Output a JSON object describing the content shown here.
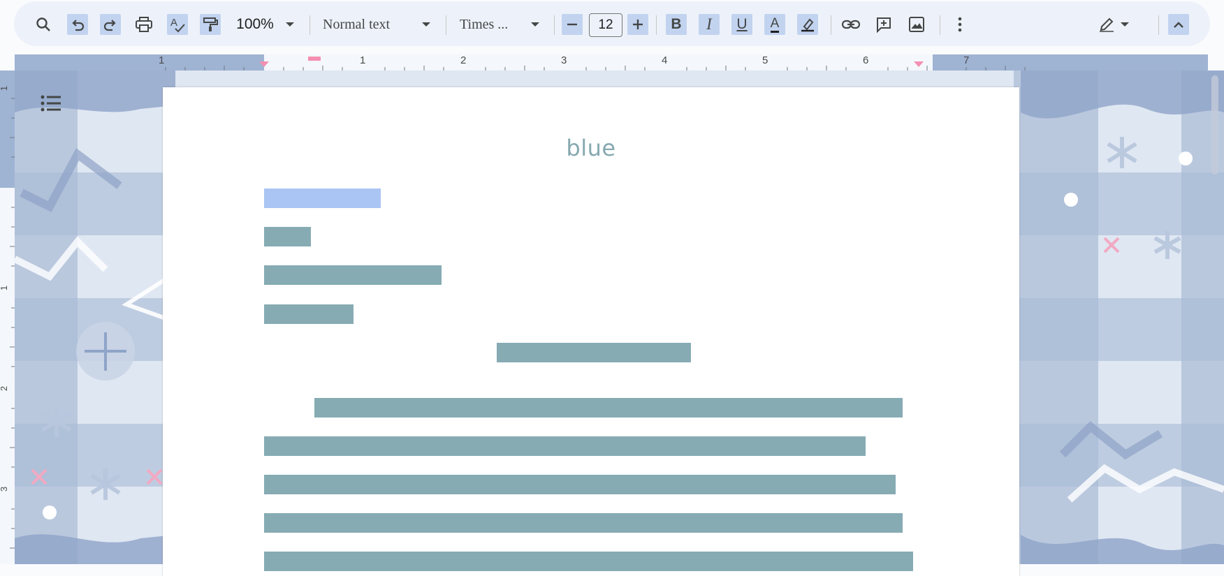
{
  "toolbar": {
    "zoom": "100%",
    "style": "Normal text",
    "font": "Times ...",
    "font_size": "12",
    "icons": {
      "search": "search-icon",
      "undo": "undo-icon",
      "redo": "redo-icon",
      "print": "print-icon",
      "spellcheck": "spellcheck-icon",
      "paint_format": "paint-format-icon",
      "decrease": "minus-icon",
      "increase": "plus-icon",
      "bold": "B",
      "italic": "I",
      "underline": "U",
      "text_color": "A",
      "highlight": "highlighter-icon",
      "link": "link-icon",
      "comment": "add-comment-icon",
      "image": "image-icon",
      "more": "more-vert-icon",
      "editing": "pencil-icon",
      "collapse": "chevron-up-icon"
    }
  },
  "ruler": {
    "h_numbers": [
      "1",
      "1",
      "2",
      "3",
      "4",
      "5",
      "6",
      "7"
    ],
    "v_numbers": [
      "1",
      "1",
      "2",
      "3"
    ]
  },
  "document": {
    "title": "blue"
  },
  "colors": {
    "accent": "#c2d3f0",
    "title": "#86a9b0",
    "text_bar": "#86abb3",
    "selection": "#aac4f3"
  }
}
